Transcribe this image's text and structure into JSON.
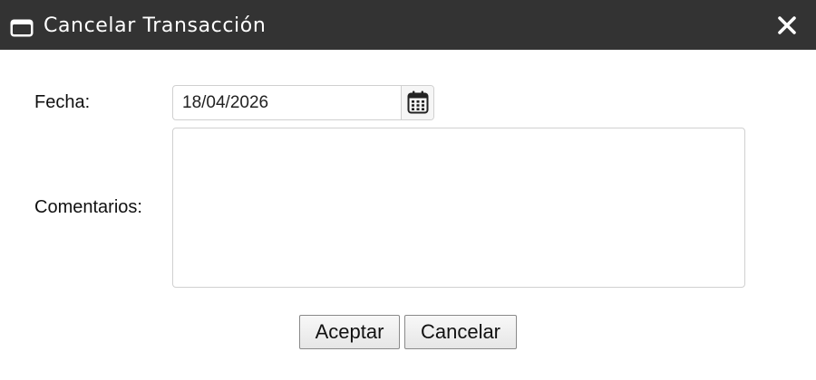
{
  "dialog": {
    "title": "Cancelar Transacción",
    "title_icon": "window-icon",
    "close_icon": "close-icon"
  },
  "form": {
    "date_label": "Fecha:",
    "date_value": "18/04/2026",
    "calendar_icon": "calendar-icon",
    "comments_label": "Comentarios:",
    "comments_value": ""
  },
  "buttons": {
    "accept_label": "Aceptar",
    "cancel_label": "Cancelar"
  },
  "colors": {
    "titlebar": "#333333",
    "title_text": "#ffffff"
  }
}
